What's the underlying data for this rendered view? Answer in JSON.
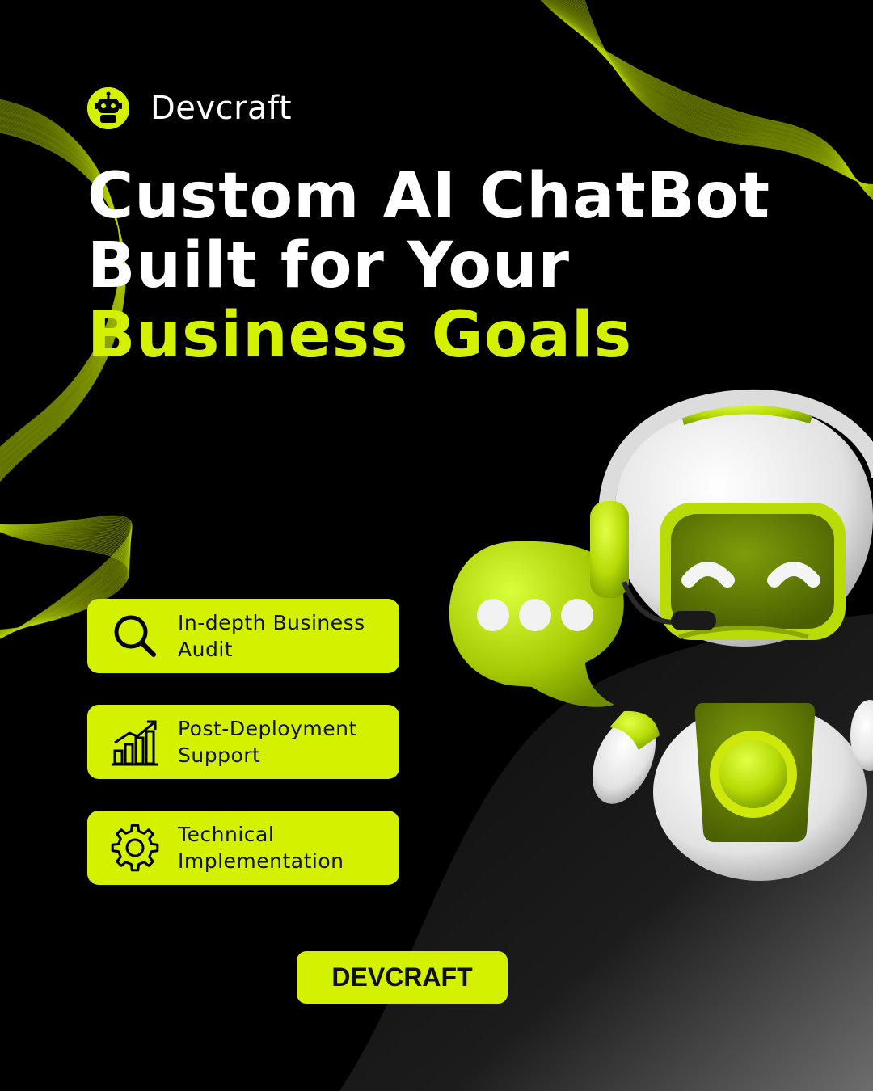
{
  "brand": {
    "name": "Devcraft",
    "accent_color": "#d4f200",
    "logo_icon": "robot-head-icon"
  },
  "headline": {
    "line1": "Custom AI ChatBot",
    "line2": "Built for Your",
    "line3": "Business Goals"
  },
  "features": [
    {
      "icon": "search-icon",
      "label": "In-depth Business\nAudit"
    },
    {
      "icon": "growth-chart-icon",
      "label": "Post-Deployment\nSupport"
    },
    {
      "icon": "gear-icon",
      "label": "Technical\nImplementation"
    }
  ],
  "cta": {
    "label": "DEVCRAFT"
  },
  "illustration": {
    "subject": "robot-with-headset-icon",
    "bubble": "chat-bubble-icon"
  },
  "colors": {
    "background": "#000000",
    "accent": "#d4f200",
    "text": "#ffffff"
  }
}
